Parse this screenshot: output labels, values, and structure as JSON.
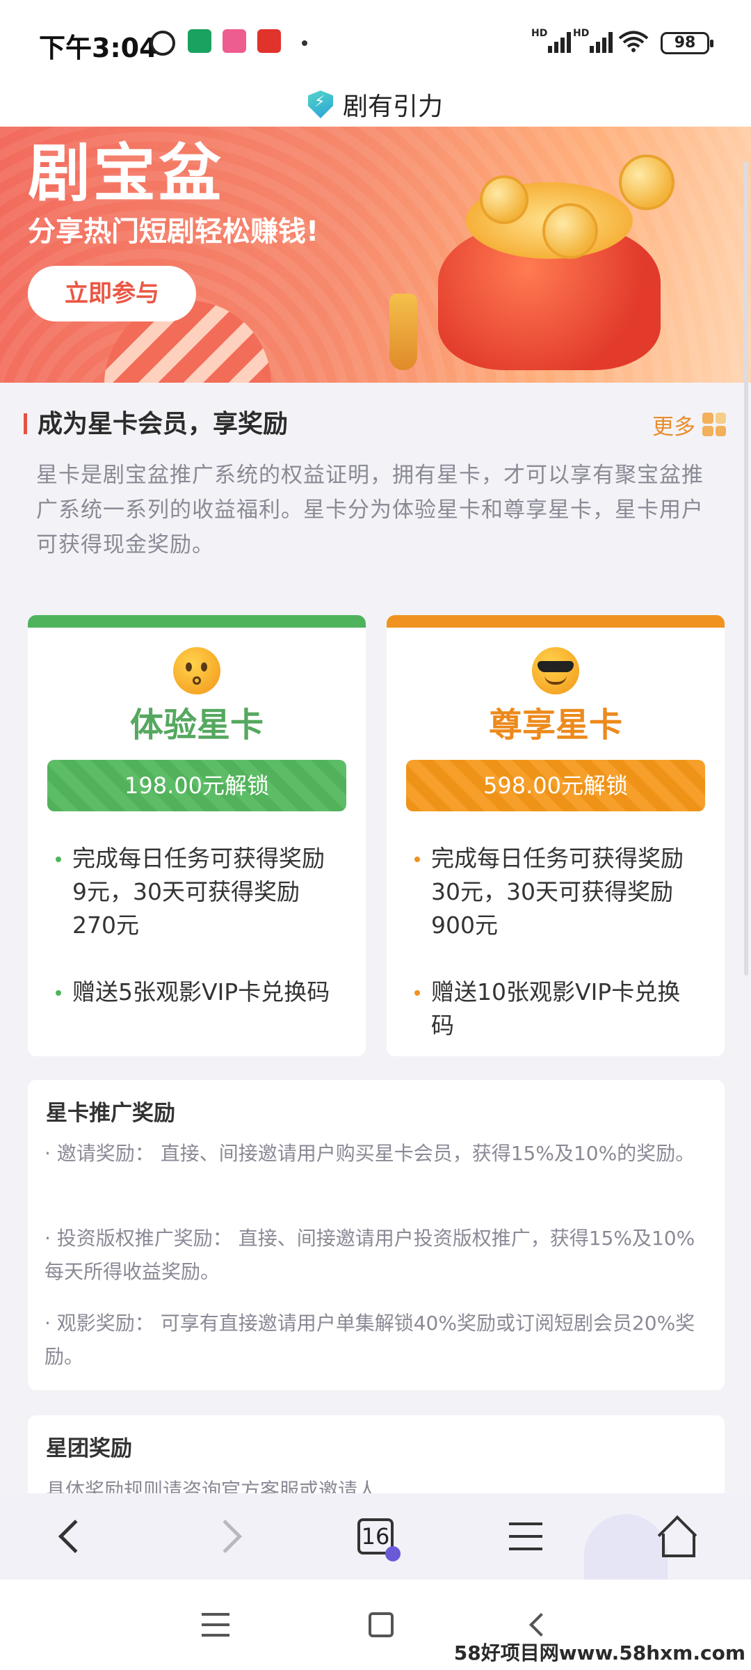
{
  "status_bar": {
    "time": "下午3:04",
    "network_1": "HD",
    "network_2": "HD",
    "battery": "98"
  },
  "header": {
    "site_title": "剧有引力"
  },
  "banner": {
    "title": "剧宝盆",
    "subtitle": "分享热门短剧轻松赚钱!",
    "cta": "立即参与"
  },
  "membership": {
    "title": "成为星卡会员，享奖励",
    "more": "更多",
    "intro": "星卡是剧宝盆推广系统的权益证明，拥有星卡，才可以享有聚宝盆推广系统一系列的收益福利。星卡分为体验星卡和尊享星卡，星卡用户可获得现金奖励。",
    "cards": [
      {
        "title": "体验星卡",
        "unlock": "198.00元解锁",
        "benefits": [
          "完成每日任务可获得奖励9元，30天可获得奖励270元",
          "赠送5张观影VIP卡兑换码"
        ],
        "color": "#4fb35b"
      },
      {
        "title": "尊享星卡",
        "unlock": "598.00元解锁",
        "benefits": [
          "完成每日任务可获得奖励30元，30天可获得奖励900元",
          "赠送10张观影VIP卡兑换码"
        ],
        "color": "#f0921f"
      }
    ]
  },
  "promo_rewards": {
    "title": "星卡推广奖励",
    "items": [
      "· 邀请奖励：  直接、间接邀请用户购买星卡会员，获得15%及10%的奖励。",
      "· 投资版权推广奖励：  直接、间接邀请用户投资版权推广，获得15%及10%每天所得收益奖励。",
      "· 观影奖励：  可享有直接邀请用户单集解锁40%奖励或订阅短剧会员20%奖励。"
    ]
  },
  "team_rewards": {
    "title": "星团奖励",
    "desc": "具体奖励规则请咨询官方客服或邀请人"
  },
  "browser_toolbar": {
    "tab_count": "16"
  },
  "watermark": "58好项目网www.58hxm.com"
}
